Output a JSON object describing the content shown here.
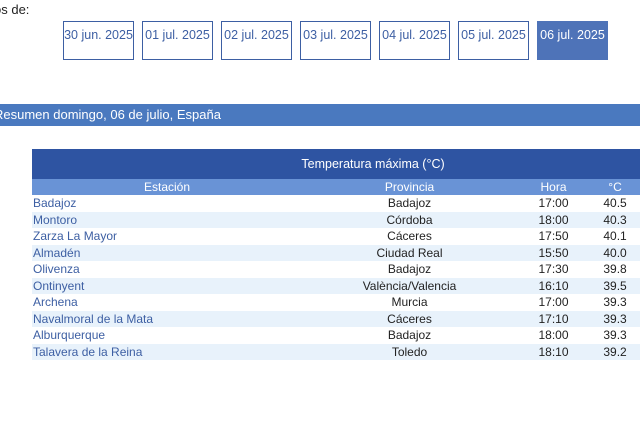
{
  "prefix_label": "os de:",
  "date_tabs": [
    {
      "label": "30 jun. 2025",
      "active": false
    },
    {
      "label": "01 jul. 2025",
      "active": false
    },
    {
      "label": "02 jul. 2025",
      "active": false
    },
    {
      "label": "03 jul. 2025",
      "active": false
    },
    {
      "label": "04 jul. 2025",
      "active": false
    },
    {
      "label": "05 jul. 2025",
      "active": false
    },
    {
      "label": "06 jul. 2025",
      "active": true
    }
  ],
  "summary": {
    "title": "Resumen domingo, 06 de julio, España"
  },
  "table": {
    "caption": "Temperatura máxima (°C)",
    "columns": {
      "station": "Estación",
      "province": "Provincia",
      "hour": "Hora",
      "temp": "°C"
    },
    "rows": [
      {
        "station": "Badajoz",
        "province": "Badajoz",
        "hour": "17:00",
        "temp": "40.5"
      },
      {
        "station": "Montoro",
        "province": "Córdoba",
        "hour": "18:00",
        "temp": "40.3"
      },
      {
        "station": "Zarza La Mayor",
        "province": "Cáceres",
        "hour": "17:50",
        "temp": "40.1"
      },
      {
        "station": "Almadén",
        "province": "Ciudad Real",
        "hour": "15:50",
        "temp": "40.0"
      },
      {
        "station": "Olivenza",
        "province": "Badajoz",
        "hour": "17:30",
        "temp": "39.8"
      },
      {
        "station": "Ontinyent",
        "province": "València/Valencia",
        "hour": "16:10",
        "temp": "39.5"
      },
      {
        "station": "Archena",
        "province": "Murcia",
        "hour": "17:00",
        "temp": "39.3"
      },
      {
        "station": "Navalmoral de la Mata",
        "province": "Cáceres",
        "hour": "17:10",
        "temp": "39.3"
      },
      {
        "station": "Alburquerque",
        "province": "Badajoz",
        "hour": "18:00",
        "temp": "39.3"
      },
      {
        "station": "Talavera de la Reina",
        "province": "Toledo",
        "hour": "18:10",
        "temp": "39.2"
      }
    ]
  },
  "colors": {
    "accent": "#4e73b8",
    "summary_bar": "#4a79bf",
    "table_caption": "#2e54a2",
    "table_header": "#6993d6",
    "row_alt": "#e8f2fb",
    "link": "#3d5fa3"
  }
}
